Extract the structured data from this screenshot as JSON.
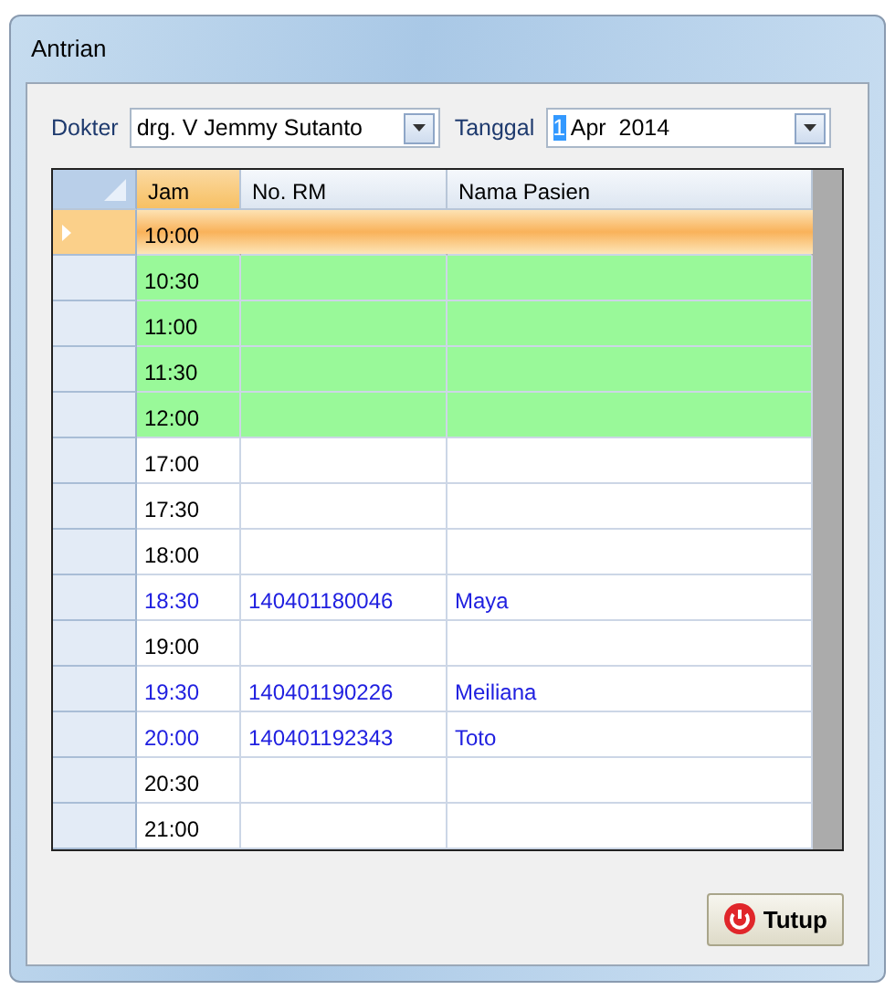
{
  "window": {
    "title": "Antrian"
  },
  "filters": {
    "doctor_label": "Dokter",
    "doctor": "drg. V Jemmy Sutanto",
    "date_label": "Tanggal",
    "date_highlighted": "1",
    "date_rest": "Apr  2014"
  },
  "table": {
    "columns": [
      "Jam",
      "No. RM",
      "Nama Pasien"
    ],
    "rows": [
      {
        "jam": "10:00",
        "no_rm": "",
        "nama": "",
        "kind": "open",
        "selected": true
      },
      {
        "jam": "10:30",
        "no_rm": "",
        "nama": "",
        "kind": "open",
        "selected": false
      },
      {
        "jam": "11:00",
        "no_rm": "",
        "nama": "",
        "kind": "open",
        "selected": false
      },
      {
        "jam": "11:30",
        "no_rm": "",
        "nama": "",
        "kind": "open",
        "selected": false
      },
      {
        "jam": "12:00",
        "no_rm": "",
        "nama": "",
        "kind": "open",
        "selected": false
      },
      {
        "jam": "17:00",
        "no_rm": "",
        "nama": "",
        "kind": "free",
        "selected": false
      },
      {
        "jam": "17:30",
        "no_rm": "",
        "nama": "",
        "kind": "free",
        "selected": false
      },
      {
        "jam": "18:00",
        "no_rm": "",
        "nama": "",
        "kind": "free",
        "selected": false
      },
      {
        "jam": "18:30",
        "no_rm": "140401180046",
        "nama": "Maya",
        "kind": "booked",
        "selected": false
      },
      {
        "jam": "19:00",
        "no_rm": "",
        "nama": "",
        "kind": "free",
        "selected": false
      },
      {
        "jam": "19:30",
        "no_rm": "140401190226",
        "nama": "Meiliana",
        "kind": "booked",
        "selected": false
      },
      {
        "jam": "20:00",
        "no_rm": "140401192343",
        "nama": "Toto",
        "kind": "booked",
        "selected": false
      },
      {
        "jam": "20:30",
        "no_rm": "",
        "nama": "",
        "kind": "free",
        "selected": false
      },
      {
        "jam": "21:00",
        "no_rm": "",
        "nama": "",
        "kind": "free",
        "selected": false
      }
    ]
  },
  "buttons": [
    {
      "label": "Tutup"
    }
  ]
}
